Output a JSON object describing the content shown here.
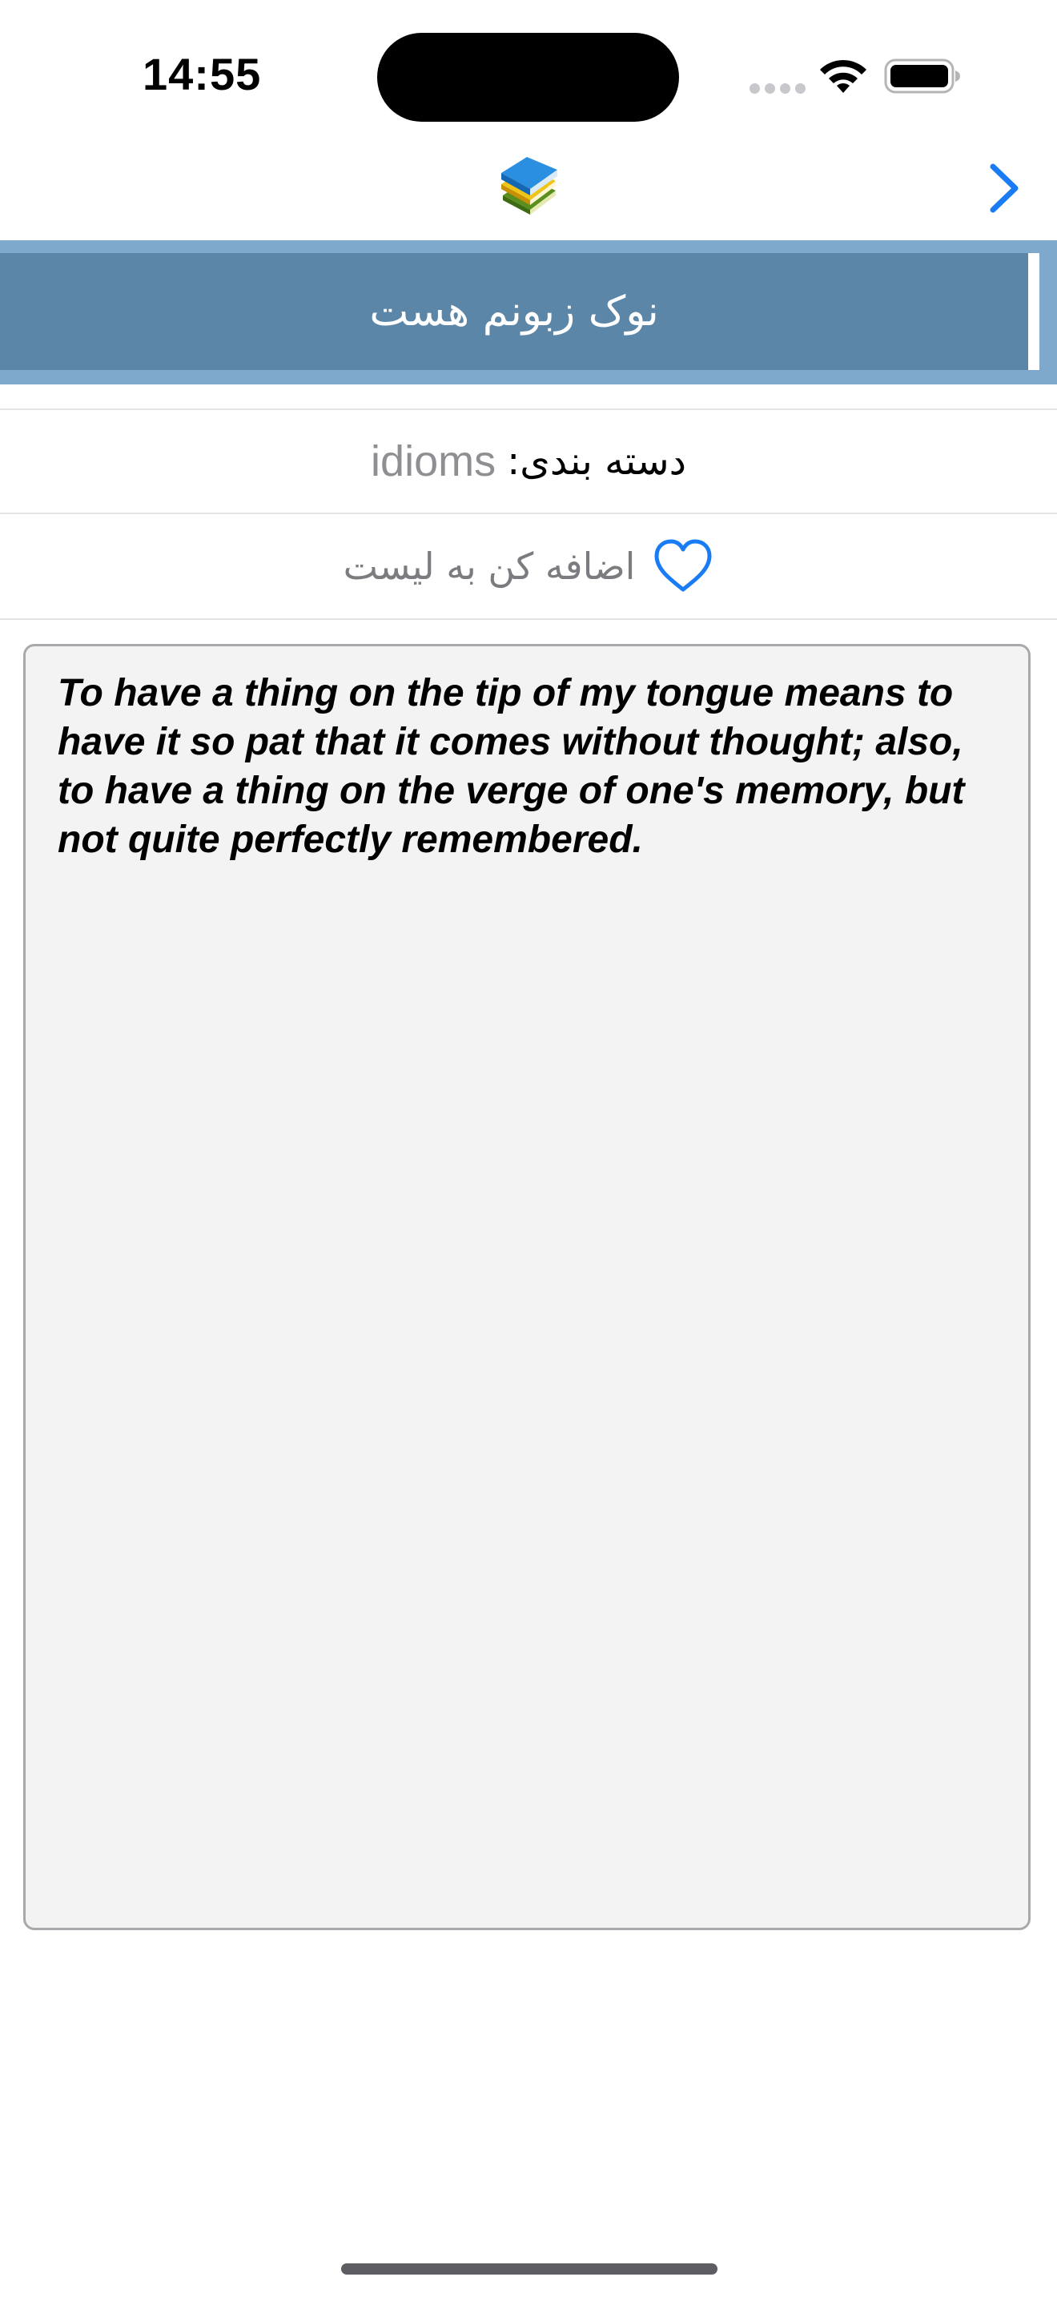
{
  "status_bar": {
    "time": "14:55",
    "icons": [
      "cellular-signal-icon",
      "wifi-icon",
      "battery-icon"
    ]
  },
  "nav_bar": {
    "center_icon": "books-icon",
    "right_icon": "chevron-right-icon"
  },
  "title": "نوک زبونم هست",
  "category": {
    "label": "دسته بندی:",
    "value": "idioms"
  },
  "favorite": {
    "label": "اضافه کن به لیست",
    "icon": "heart-outline-icon"
  },
  "definition": "To have a thing on the tip of my tongue means to have it so pat that it comes without thought; also, to have a thing on the verge of one's memory, but not quite perfectly remembered.",
  "colors": {
    "banner_outer": "#7ea8cc",
    "banner_inner": "#5c86a8",
    "accent_blue": "#1a7cf5",
    "text_gray": "#8e8e93",
    "box_background": "#f3f3f3"
  }
}
